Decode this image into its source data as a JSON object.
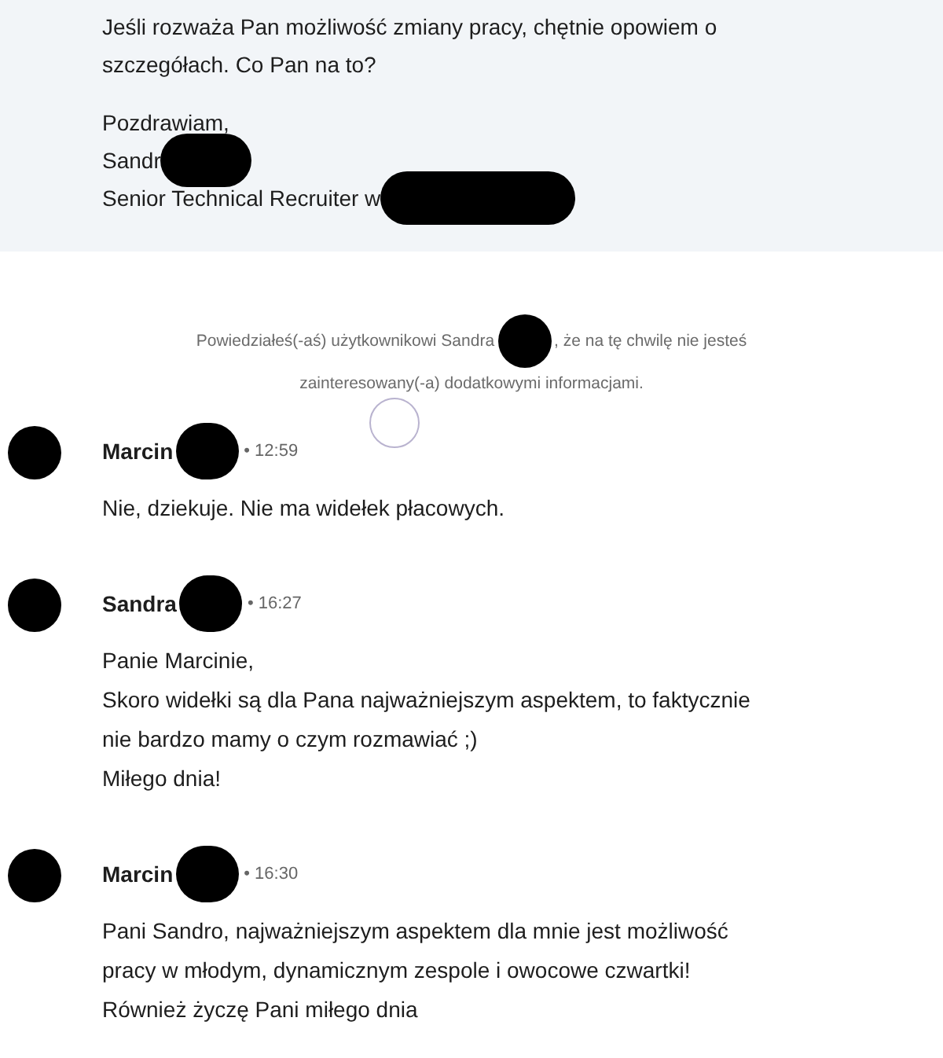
{
  "quoted_message": {
    "lines": [
      {
        "text": "Jeśli rozważa Pan możliwość zmiany pracy, chętnie opowiem o",
        "redacted": false,
        "gap_before": false
      },
      {
        "text": "szczegółach. Co Pan na to?",
        "redacted": false,
        "gap_before": false
      },
      {
        "text": "Pozdrawiam,",
        "redacted": false,
        "gap_before": true
      },
      {
        "text": "Sandr",
        "redacted": true,
        "gap_before": false
      },
      {
        "text": "Senior Technical Recruiter w",
        "redacted": true,
        "gap_before": false
      }
    ]
  },
  "notice": {
    "before": "Powiedziałeś(-aś) użytkownikowi Sandra",
    "redacted": true,
    "after": ", że na tę chwilę nie jesteś",
    "line_2": "zainteresowany(-a) dodatkowymi informacjami."
  },
  "messages": [
    {
      "sender": "Marcin",
      "redacted": true,
      "time": "• 12:59",
      "seen_marker": true,
      "lines": [
        "Nie, dziekuje. Nie ma widełek płacowych."
      ]
    },
    {
      "sender": "Sandra",
      "redacted": true,
      "time": "• 16:27",
      "seen_marker": false,
      "lines": [
        "Panie Marcinie,",
        "Skoro widełki są dla Pana najważniejszym aspektem, to faktycznie",
        "nie bardzo mamy o czym rozmawiać ;)",
        "Miłego dnia!"
      ]
    },
    {
      "sender": "Marcin",
      "redacted": true,
      "time": "• 16:30",
      "seen_marker": false,
      "lines": [
        "Pani Sandro, najważniejszym aspektem dla mnie jest możliwość",
        "pracy w młodym, dynamicznym zespole i owocowe czwartki!",
        "Również życzę Pani miłego dnia"
      ]
    }
  ]
}
